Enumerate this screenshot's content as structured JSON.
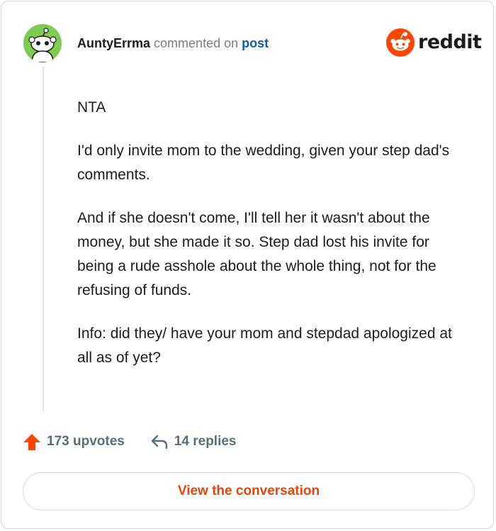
{
  "header": {
    "username": "AuntyErrma",
    "action_text": "commented on",
    "post_link": "post"
  },
  "brand": {
    "wordmark": "reddit",
    "accent": "#ff4500"
  },
  "comment": {
    "paragraphs": [
      "NTA",
      "I'd only invite mom to the wedding, given your step dad's comments.",
      "And if she doesn't come, I'll tell her it wasn't about the money, but she made it so. Step dad lost his invite for being a rude asshole about the whole thing, not for the refusing of funds.",
      "Info: did they/ have your mom and stepdad apologized at all as of yet?"
    ]
  },
  "actions": {
    "upvotes_label": "173 upvotes",
    "replies_label": "14 replies"
  },
  "cta": {
    "label": "View the conversation"
  },
  "colors": {
    "avatar_bg": "#7ecb52",
    "link": "#0b5cb7",
    "muted": "#576f76",
    "cta_text": "#e2470c"
  }
}
